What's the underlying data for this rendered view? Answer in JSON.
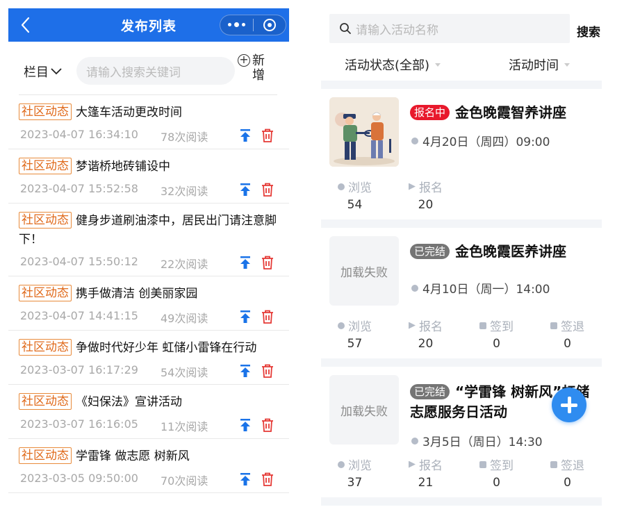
{
  "left": {
    "nav": {
      "title": "发布列表"
    },
    "filter": {
      "category_label": "栏目",
      "search_placeholder": "请输入搜索关键词",
      "add_label": "新增"
    },
    "items": [
      {
        "tag": "社区动态",
        "title": "大篷车活动更改时间",
        "date": "2023-04-07 16:34:10",
        "reads": "78次阅读"
      },
      {
        "tag": "社区动态",
        "title": "梦谐桥地砖铺设中",
        "date": "2023-04-07 15:52:58",
        "reads": "32次阅读"
      },
      {
        "tag": "社区动态",
        "title": "健身步道刷油漆中，居民出门请注意脚下！",
        "date": "2023-04-07 15:50:12",
        "reads": "22次阅读"
      },
      {
        "tag": "社区动态",
        "title": "携手做清洁 创美丽家园",
        "date": "2023-04-07 14:41:15",
        "reads": "49次阅读"
      },
      {
        "tag": "社区动态",
        "title": "争做时代好少年 虹储小雷锋在行动",
        "date": "2023-03-07 16:17:29",
        "reads": "54次阅读"
      },
      {
        "tag": "社区动态",
        "title": "《妇保法》宣讲活动",
        "date": "2023-03-07 16:16:05",
        "reads": "11次阅读"
      },
      {
        "tag": "社区动态",
        "title": "学雷锋 做志愿 树新风",
        "date": "2023-03-05 09:50:00",
        "reads": "70次阅读"
      }
    ]
  },
  "right": {
    "search": {
      "placeholder": "请输入活动名称",
      "button": "搜索"
    },
    "filters": {
      "status": "活动状态(全部)",
      "time": "活动时间"
    },
    "activities": [
      {
        "status": "报名中",
        "title": "金色晚霞智养讲座",
        "time": "4月20日（周四）09:00",
        "thumb_fail": "",
        "stats": [
          {
            "label": "浏览",
            "value": "54"
          },
          {
            "label": "报名",
            "value": "20"
          }
        ]
      },
      {
        "status": "已完结",
        "title": "金色晚霞医养讲座",
        "time": "4月10日（周一）14:00",
        "thumb_fail": "加载失败",
        "stats": [
          {
            "label": "浏览",
            "value": "57"
          },
          {
            "label": "报名",
            "value": "20"
          },
          {
            "label": "签到",
            "value": "0"
          },
          {
            "label": "签退",
            "value": "0"
          }
        ]
      },
      {
        "status": "已完结",
        "title": "“学雷锋 树新风”虹储志愿服务日活动",
        "time": "3月5日（周日）14:30",
        "thumb_fail": "加载失败",
        "stats": [
          {
            "label": "浏览",
            "value": "37"
          },
          {
            "label": "报名",
            "value": "21"
          },
          {
            "label": "签到",
            "value": "0"
          },
          {
            "label": "签退",
            "value": "0"
          }
        ]
      }
    ]
  },
  "colors": {
    "nav_bg": "#1e6fe8",
    "tag": "#e06a1b",
    "action_blue": "#1a73e8",
    "delete_red": "#e53935",
    "status_open": "#e8192c",
    "status_done": "#757575",
    "fab": "#2f8cf0"
  }
}
